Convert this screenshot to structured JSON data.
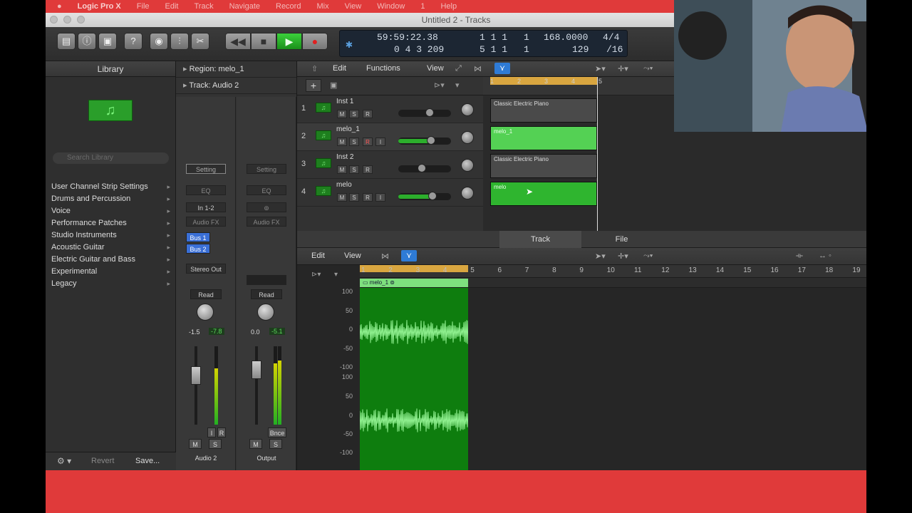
{
  "menubar": {
    "items": [
      "Logic Pro X",
      "File",
      "Edit",
      "Track",
      "Navigate",
      "Record",
      "Mix",
      "View",
      "Window",
      "1",
      "Help"
    ]
  },
  "window": {
    "title": "Untitled 2 - Tracks"
  },
  "lcd": {
    "time": "59:59:22.38",
    "bars": "0 4 3 209",
    "pos1": "1  1  1",
    "pos1b": "1",
    "pos2": "5  1  1",
    "pos2b": "1",
    "tempo": "168.0000",
    "tempo_sub": "129",
    "sig": "4/4",
    "div": "/16"
  },
  "library": {
    "title": "Library",
    "search_placeholder": "Search Library",
    "items": [
      "User Channel Strip Settings",
      "Drums and Percussion",
      "Voice",
      "Performance Patches",
      "Studio Instruments",
      "Acoustic Guitar",
      "Electric Guitar and Bass",
      "Experimental",
      "Legacy"
    ],
    "revert": "Revert",
    "save": "Save..."
  },
  "inspector": {
    "region": "Region: melo_1",
    "track": "Track: Audio 2",
    "strip1": {
      "setting": "Setting",
      "eq": "EQ",
      "input": "In 1-2",
      "fx": "Audio FX",
      "bus1": "Bus 1",
      "bus2": "Bus 2",
      "out": "Stereo Out",
      "auto": "Read",
      "vol": "-1.5",
      "peak": "-7.8",
      "i": "I",
      "r": "R",
      "m": "M",
      "s": "S",
      "name": "Audio 2"
    },
    "strip2": {
      "setting": "Setting",
      "eq": "EQ",
      "fx": "Audio FX",
      "auto": "Read",
      "vol": "0.0",
      "peak": "-5.1",
      "bnce": "Bnce",
      "m": "M",
      "s": "S",
      "name": "Output"
    }
  },
  "tracks_toolbar": {
    "edit": "Edit",
    "functions": "Functions",
    "view": "View"
  },
  "tracks": [
    {
      "num": "1",
      "name": "Inst 1",
      "vol": 0.6
    },
    {
      "num": "2",
      "name": "melo_1",
      "vol": 0.62
    },
    {
      "num": "3",
      "name": "Inst 2",
      "vol": 0.45
    },
    {
      "num": "4",
      "name": "melo",
      "vol": 0.65
    }
  ],
  "ruler": [
    "1",
    "2",
    "3",
    "4",
    "5"
  ],
  "regions": {
    "r1": "Classic Electric Piano",
    "r2": "melo_1",
    "r3": "Classic Electric Piano",
    "r4": "melo"
  },
  "bottom": {
    "tab_track": "Track",
    "tab_file": "File",
    "edit": "Edit",
    "view": "View",
    "ruler": [
      "1",
      "2",
      "3",
      "4",
      "5",
      "6",
      "7",
      "8",
      "9",
      "10",
      "11",
      "12",
      "13",
      "14",
      "15",
      "16",
      "17",
      "18",
      "19"
    ],
    "region": "melo_1",
    "scale": [
      "100",
      "50",
      "0",
      "-50",
      "-100",
      "100",
      "50",
      "0",
      "-50",
      "-100"
    ]
  },
  "colors": {
    "accent": "#e03a3a",
    "audio": "#2fb52f",
    "cycle": "#d9a640"
  }
}
